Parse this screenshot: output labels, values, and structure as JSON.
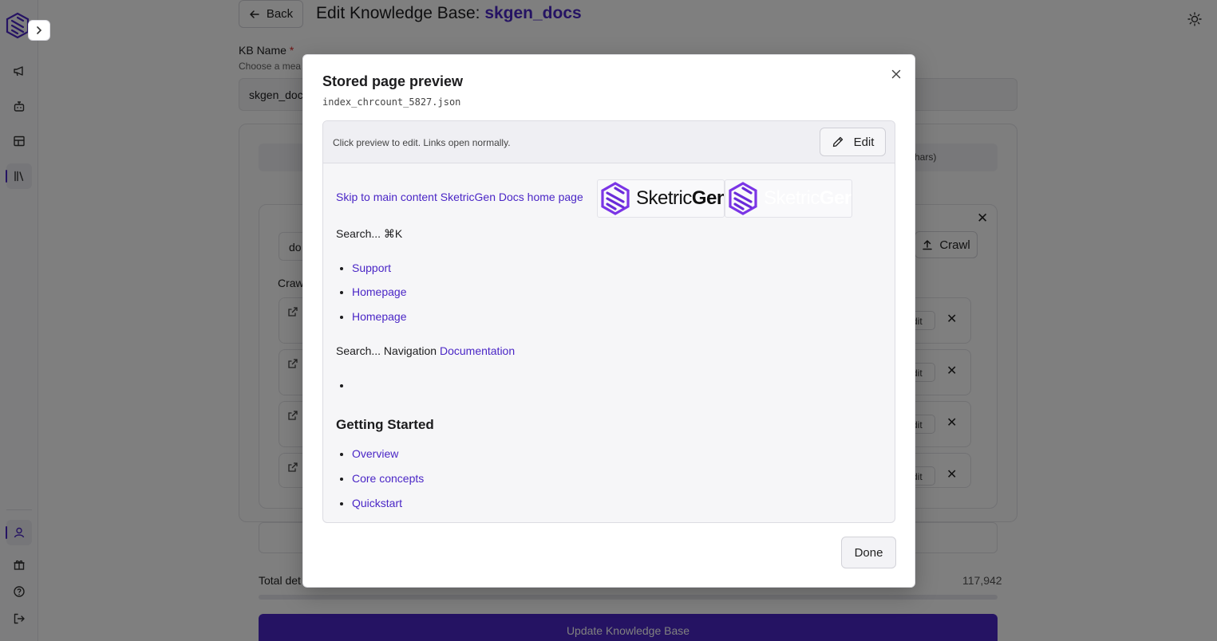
{
  "header": {
    "back_label": "Back",
    "title_prefix": "Edit Knowledge Base:",
    "kb_slug": "skgen_docs"
  },
  "form": {
    "kb_name_label": "KB Name",
    "required_mark": "*",
    "kb_name_hint": "Choose a mea",
    "kb_name_value": "skgen_doc",
    "tab_strip_text": "chars)",
    "source_input_value": "do",
    "crawl_button_label": "Crawl",
    "crawled_label": "Craw",
    "row_edit_label": "dit",
    "total_label": "Total det",
    "total_value": "117,942",
    "update_button_label": "Update Knowledge Base",
    "progress_fraction": 0.0
  },
  "modal": {
    "title": "Stored page preview",
    "file_name": "index_chrcount_5827.json",
    "preview_hint": "Click preview to edit. Links open normally.",
    "edit_label": "Edit",
    "done_label": "Done",
    "content": {
      "skip_link": "Skip to main content",
      "home_link": "SketricGen Docs home page",
      "logo_text_a": "Sketric",
      "logo_text_b": "Gen",
      "search_shortcut": "Search... ⌘K",
      "nav_links": [
        "Support",
        "Homepage",
        "Homepage"
      ],
      "search_nav_text": "Search... Navigation",
      "documentation_link": "Documentation",
      "empty_bullet": "",
      "section_heading": "Getting Started",
      "getting_started_links": [
        "Overview",
        "Core concepts",
        "Quickstart"
      ]
    }
  },
  "colors": {
    "accent": "#4a26c6",
    "overlay": "rgba(0,0,0,0.5)"
  },
  "icons": {
    "sidebar": [
      "megaphone-icon",
      "bot-icon",
      "layout-icon",
      "library-icon",
      "user-icon",
      "gift-icon",
      "help-icon",
      "logout-icon"
    ]
  }
}
